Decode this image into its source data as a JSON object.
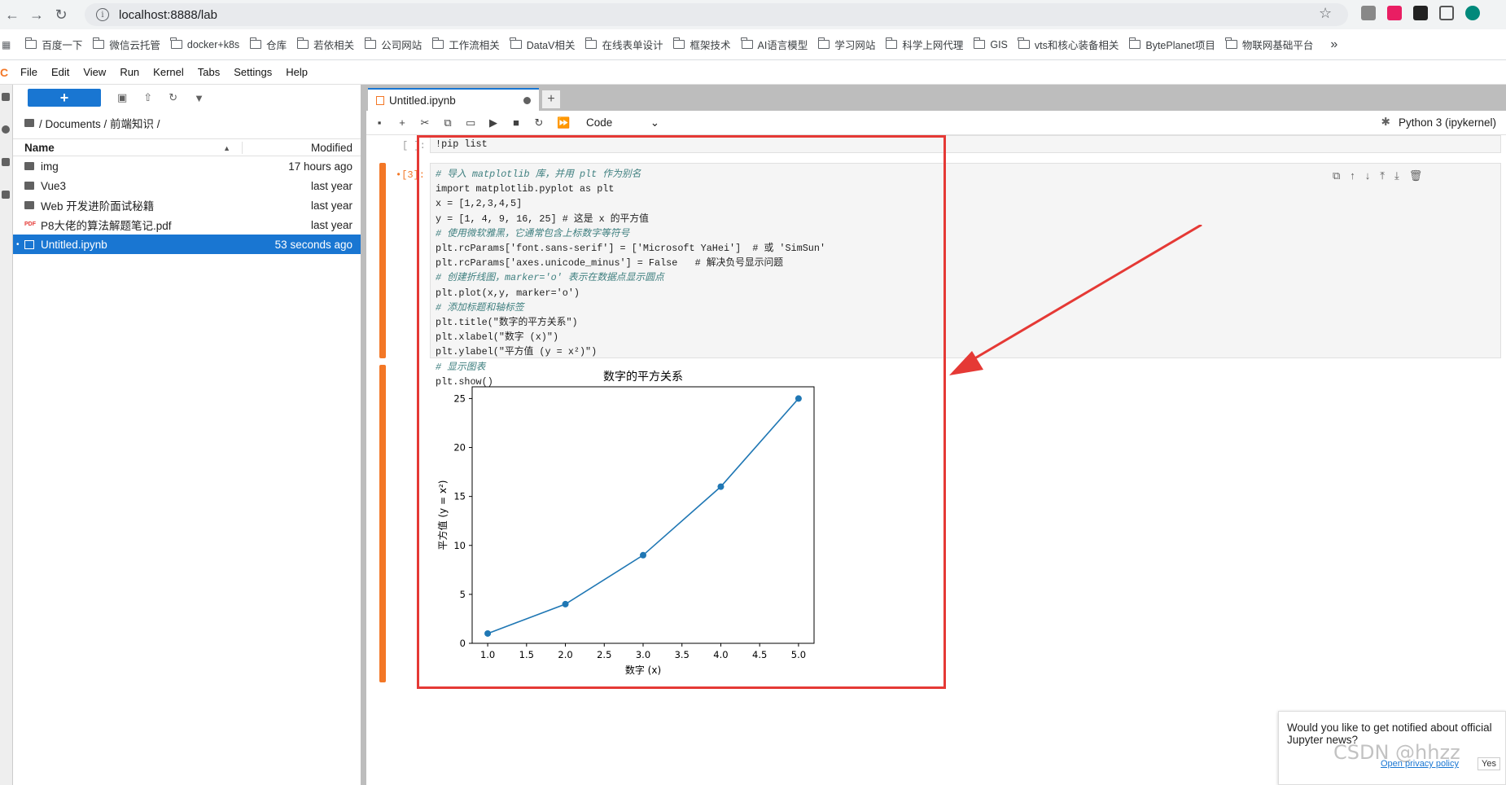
{
  "browser": {
    "url": "localhost:8888/lab"
  },
  "bookmarks": [
    "百度一下",
    "微信云托管",
    "docker+k8s",
    "仓库",
    "若依相关",
    "公司网站",
    "工作流相关",
    "DataV相关",
    "在线表单设计",
    "框架技术",
    "AI语言模型",
    "学习网站",
    "科学上网代理",
    "GIS",
    "vts和核心装备相关",
    "BytePlanet项目",
    "物联网基础平台"
  ],
  "bookmarks_more": "»",
  "menu": [
    "File",
    "Edit",
    "View",
    "Run",
    "Kernel",
    "Tabs",
    "Settings",
    "Help"
  ],
  "filebrowser": {
    "breadcrumb": "/ Documents / 前端知识 /",
    "col_name": "Name",
    "col_modified": "Modified",
    "rows": [
      {
        "name": "img",
        "modified": "17 hours ago"
      },
      {
        "name": "Vue3",
        "modified": "last year"
      },
      {
        "name": "Web 开发进阶面试秘籍",
        "modified": "last year"
      },
      {
        "name": "P8大佬的算法解题笔记.pdf",
        "modified": "last year",
        "pdf_tag": "PDF"
      },
      {
        "name": "Untitled.ipynb",
        "modified": "53 seconds ago"
      }
    ]
  },
  "notebook": {
    "tab_title": "Untitled.ipynb",
    "cell_type": "Code",
    "kernel": "Python 3 (ipykernel)",
    "cell1_prompt": "[ ]:",
    "cell1_code": "!pip list",
    "cell2_prompt": "•[3]:",
    "code_lines": [
      "# 导入 matplotlib 库，并用 plt 作为别名",
      "import matplotlib.pyplot as plt",
      "x = [1,2,3,4,5]",
      "y = [1, 4, 9, 16, 25] # 这是 x 的平方值",
      "# 使用微软雅黑，它通常包含上标数字等符号",
      "plt.rcParams['font.sans-serif'] = ['Microsoft YaHei']  # 或 'SimSun'",
      "plt.rcParams['axes.unicode_minus'] = False   # 解决负号显示问题",
      "# 创建折线图，marker='o' 表示在数据点显示圆点",
      "plt.plot(x,y, marker='o')",
      "# 添加标题和轴标签",
      "plt.title(\"数字的平方关系\")",
      "plt.xlabel(\"数字 (x)\")",
      "plt.ylabel(\"平方值 (y = x²)\")",
      "# 显示图表",
      "plt.show()"
    ]
  },
  "chart_data": {
    "type": "line",
    "title": "数字的平方关系",
    "xlabel": "数字 (x)",
    "ylabel": "平方值 (y = x²)",
    "x": [
      1,
      2,
      3,
      4,
      5
    ],
    "y": [
      1,
      4,
      9,
      16,
      25
    ],
    "xlim": [
      0.8,
      5.2
    ],
    "ylim": [
      0,
      26.2
    ],
    "xticks": [
      "1.0",
      "1.5",
      "2.0",
      "2.5",
      "3.0",
      "3.5",
      "4.0",
      "4.5",
      "5.0"
    ],
    "yticks": [
      "0",
      "5",
      "10",
      "15",
      "20",
      "25"
    ],
    "marker": "o",
    "color": "#1f77b4"
  },
  "notification": {
    "text": "Would you like to get notified about official Jupyter news?",
    "privacy": "Open privacy policy",
    "yes": "Yes"
  },
  "watermark": "CSDN @hhzz",
  "colors": {
    "accent": "#1976d2",
    "jupyter": "#f37726",
    "highlight": "#e53935"
  }
}
